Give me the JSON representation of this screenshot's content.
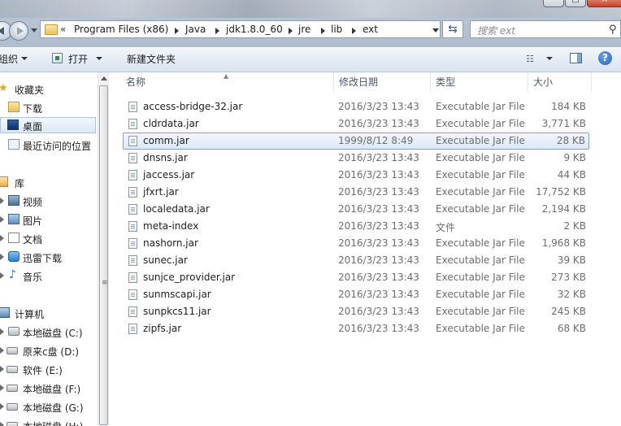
{
  "address": {
    "chevrons": "«",
    "crumbs": [
      "Program Files (x86)",
      "Java",
      "jdk1.8.0_60",
      "jre",
      "lib",
      "ext"
    ]
  },
  "search": {
    "placeholder": "搜索 ext"
  },
  "toolbar": {
    "organize": "组织",
    "open": "打开",
    "new_folder": "新建文件夹"
  },
  "nav": {
    "favorites_header": "收藏夹",
    "favorites": [
      "下载",
      "桌面",
      "最近访问的位置"
    ],
    "libraries_header": "库",
    "libraries": [
      "视频",
      "图片",
      "文档",
      "迅雷下载",
      "音乐"
    ],
    "computer_header": "计算机",
    "drives": [
      "本地磁盘 (C:)",
      "原来c盘 (D:)",
      "软件 (E:)",
      "本地磁盘 (F:)",
      "本地磁盘 (G:)",
      "本地磁盘 (H:)"
    ]
  },
  "columns": {
    "name": "名称",
    "date": "修改日期",
    "type": "类型",
    "size": "大小"
  },
  "files": [
    {
      "name": "access-bridge-32.jar",
      "date": "2016/3/23 13:43",
      "type": "Executable Jar File",
      "size": "184 KB"
    },
    {
      "name": "cldrdata.jar",
      "date": "2016/3/23 13:43",
      "type": "Executable Jar File",
      "size": "3,771 KB"
    },
    {
      "name": "comm.jar",
      "date": "1999/8/12 8:49",
      "type": "Executable Jar File",
      "size": "28 KB"
    },
    {
      "name": "dnsns.jar",
      "date": "2016/3/23 13:43",
      "type": "Executable Jar File",
      "size": "9 KB"
    },
    {
      "name": "jaccess.jar",
      "date": "2016/3/23 13:43",
      "type": "Executable Jar File",
      "size": "44 KB"
    },
    {
      "name": "jfxrt.jar",
      "date": "2016/3/23 13:43",
      "type": "Executable Jar File",
      "size": "17,752 KB"
    },
    {
      "name": "localedata.jar",
      "date": "2016/3/23 13:43",
      "type": "Executable Jar File",
      "size": "2,194 KB"
    },
    {
      "name": "meta-index",
      "date": "2016/3/23 13:43",
      "type": "文件",
      "size": "2 KB"
    },
    {
      "name": "nashorn.jar",
      "date": "2016/3/23 13:43",
      "type": "Executable Jar File",
      "size": "1,968 KB"
    },
    {
      "name": "sunec.jar",
      "date": "2016/3/23 13:43",
      "type": "Executable Jar File",
      "size": "39 KB"
    },
    {
      "name": "sunjce_provider.jar",
      "date": "2016/3/23 13:43",
      "type": "Executable Jar File",
      "size": "273 KB"
    },
    {
      "name": "sunmscapi.jar",
      "date": "2016/3/23 13:43",
      "type": "Executable Jar File",
      "size": "32 KB"
    },
    {
      "name": "sunpkcs11.jar",
      "date": "2016/3/23 13:43",
      "type": "Executable Jar File",
      "size": "245 KB"
    },
    {
      "name": "zipfs.jar",
      "date": "2016/3/23 13:43",
      "type": "Executable Jar File",
      "size": "68 KB"
    }
  ],
  "colors": {
    "selection_border": "#7da2ce",
    "selection_fill": "#dce9f8",
    "chrome": "#b9c4d2"
  }
}
